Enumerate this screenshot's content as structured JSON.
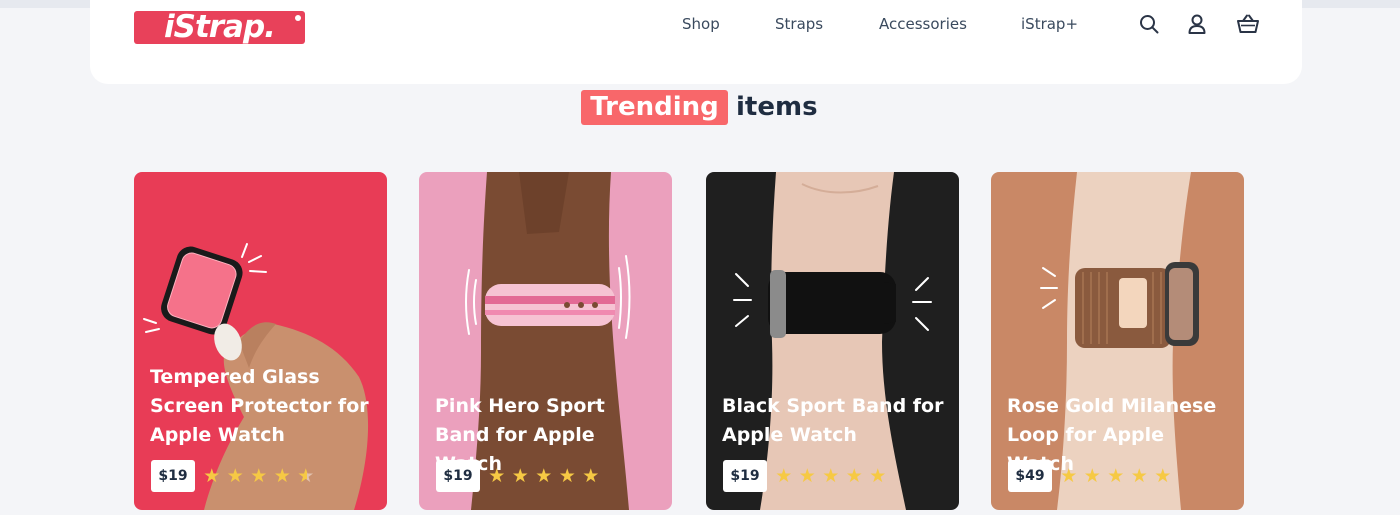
{
  "brand": {
    "name": "iStrap.",
    "color": "#e8415a"
  },
  "nav": {
    "items": [
      "Shop",
      "Straps",
      "Accessories",
      "iStrap+"
    ],
    "icons": [
      "search-icon",
      "user-icon",
      "basket-icon"
    ]
  },
  "section": {
    "highlight": "Trending",
    "rest": "items",
    "highlight_color": "#f8676a"
  },
  "products": [
    {
      "title": "Tempered Glass Screen Protector for Apple Watch",
      "price": "$19",
      "rating": 4.5,
      "bg": "#e83c56"
    },
    {
      "title": "Pink Hero Sport Band for Apple Watch",
      "price": "$19",
      "rating": 5,
      "bg": "#eba0bd"
    },
    {
      "title": "Black Sport Band for Apple Watch",
      "price": "$19",
      "rating": 5,
      "bg": "#1f1f1f"
    },
    {
      "title": "Rose Gold Milanese Loop for Apple Watch",
      "price": "$49",
      "rating": 4.8,
      "bg": "#c98866"
    }
  ],
  "colors": {
    "star": "#f6c944",
    "text_dark": "#1f2d41",
    "page_bg": "#f4f5f8"
  }
}
